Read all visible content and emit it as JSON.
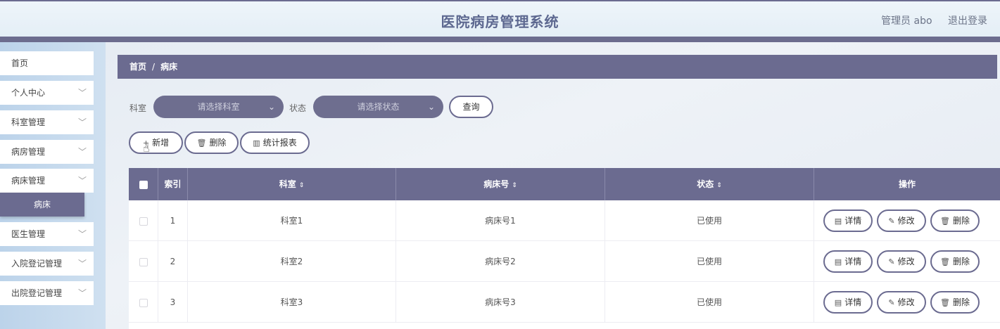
{
  "header": {
    "title": "医院病房管理系统",
    "user": "管理员 abo",
    "logout": "退出登录"
  },
  "sidebar": {
    "items": [
      {
        "label": "首页",
        "chevron": false
      },
      {
        "label": "个人中心",
        "chevron": true
      },
      {
        "label": "科室管理",
        "chevron": true
      },
      {
        "label": "病房管理",
        "chevron": true
      },
      {
        "label": "病床管理",
        "chevron": true
      },
      {
        "label": "医生管理",
        "chevron": true
      },
      {
        "label": "入院登记管理",
        "chevron": true
      },
      {
        "label": "出院登记管理",
        "chevron": true
      }
    ],
    "active_sub": "病床"
  },
  "breadcrumb": {
    "home": "首页",
    "sep": "/",
    "current": "病床"
  },
  "filters": {
    "dept_label": "科室",
    "dept_placeholder": "请选择科室",
    "status_label": "状态",
    "status_placeholder": "请选择状态",
    "query": "查询"
  },
  "toolbar": {
    "add": "新增",
    "delete": "删除",
    "stats": "统计报表"
  },
  "table": {
    "headers": {
      "index": "索引",
      "dept": "科室",
      "bed": "病床号",
      "status": "状态",
      "ops": "操作"
    },
    "sort_glyph": "⇕",
    "rows": [
      {
        "index": "1",
        "dept": "科室1",
        "bed": "病床号1",
        "status": "已使用"
      },
      {
        "index": "2",
        "dept": "科室2",
        "bed": "病床号2",
        "status": "已使用"
      },
      {
        "index": "3",
        "dept": "科室3",
        "bed": "病床号3",
        "status": "已使用"
      }
    ],
    "actions": {
      "detail": "详情",
      "edit": "修改",
      "delete": "删除"
    }
  },
  "icons": {
    "chevron": "chevron-down-icon",
    "trash": "trash-icon",
    "bar-chart": "bar-chart-icon",
    "doc": "document-icon",
    "pen": "pencil-icon",
    "cursor": "hand-pointer-icon"
  }
}
